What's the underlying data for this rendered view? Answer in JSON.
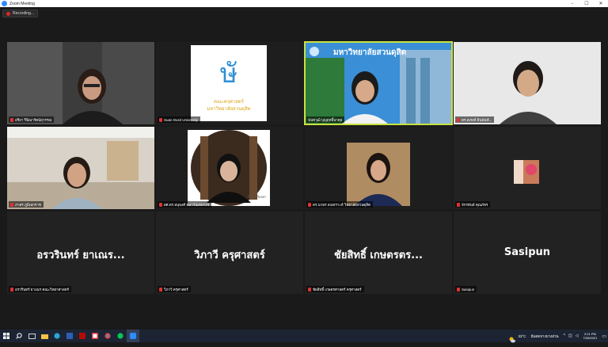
{
  "window": {
    "title": "Zoom Meeting",
    "minimize": "–",
    "maximize": "☐",
    "close": "✕"
  },
  "recording": {
    "label": "Recording..."
  },
  "participants": [
    {
      "name": "อริยา ริฉิณารัตน์สุวรรณ"
    },
    {
      "name": "Suan Dusit University"
    },
    {
      "name": "นันทวุฒิ บุญฤทธิ์นาคุล"
    },
    {
      "name": "ดร.ณรงค์ อินนันท์..."
    },
    {
      "name": "ภาสร ภูมิเอกราช"
    },
    {
      "name": "ผศ.ดร.อนุพงศ์ ธนาวันเทพากร"
    },
    {
      "name": "ดร.นวพร สงเคราะห์ วิทยาลัยสวนดุสิต"
    },
    {
      "name": "จักรพันธ์ คุณภัทร"
    },
    {
      "name": "อรวรินทร์ ยาเณร คณะวิทยาศาสตร์",
      "display": "อรวรินทร์ ยาเณร..."
    },
    {
      "name": "วิภาวี ครุศาสตร์",
      "display": "วิภาวี ครุศาสตร์"
    },
    {
      "name": "ชัยสิทธิ์ เกษตรศาสตร์ ครุศาสตร์",
      "display": "ชัยสิทธิ์ เกษตรตร..."
    },
    {
      "name": "Sasipun",
      "display": "Sasipun"
    }
  ],
  "logo": {
    "line1": "คณะครุศาสตร์",
    "line2": "มหาวิทยาลัยสวนดุสิต",
    "mark": "ษั"
  },
  "banner": {
    "text": "มหาวิทยาลัยสวนดุสิต"
  },
  "bookshelf_caption": "PhotoRoom",
  "taskbar": {
    "icons": [
      "windows-logo-icon",
      "search-icon",
      "task-view-icon",
      "file-explorer-icon",
      "edge-icon",
      "word-icon",
      "acrobat-icon",
      "photos-icon",
      "chrome-icon",
      "line-icon",
      "zoom-icon"
    ],
    "temperature": "33°C",
    "weather": "มีแดดจางบางส่วน",
    "time": "2:21 PM",
    "date": "7/26/2021"
  },
  "colors": {
    "active_speaker": "#c8e13f",
    "muted": "#e03232",
    "taskbar": "#1c2433"
  }
}
